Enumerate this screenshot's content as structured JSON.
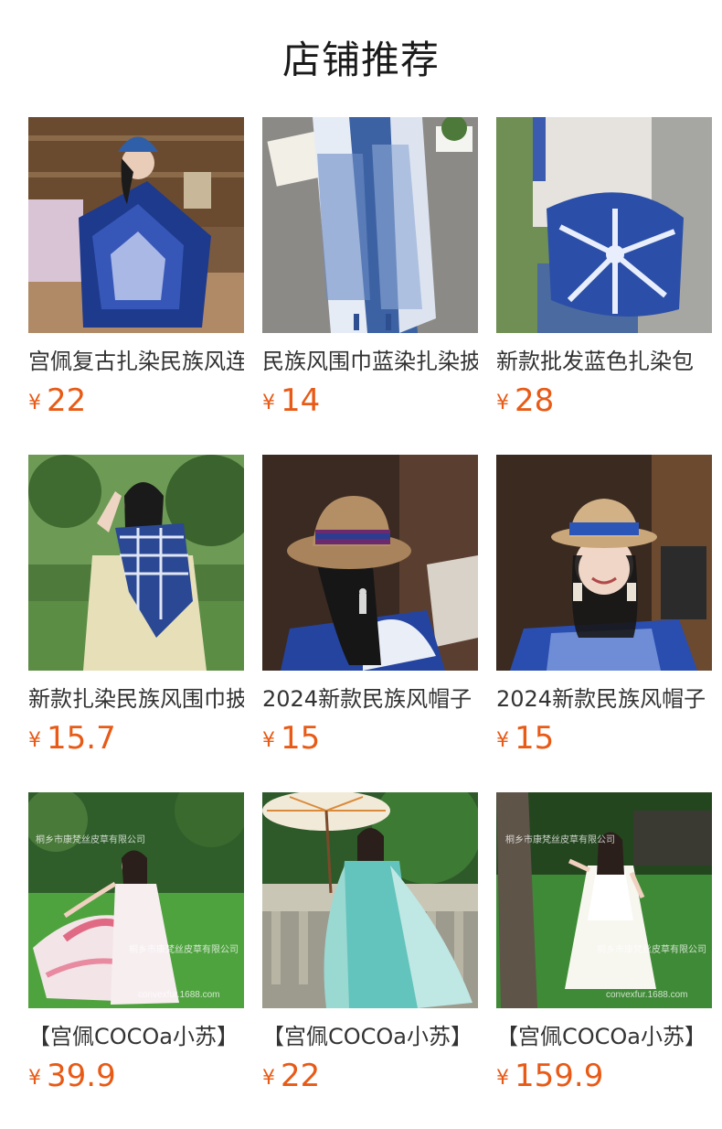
{
  "header": {
    "title": "店铺推荐"
  },
  "currency_symbol": "¥",
  "colors": {
    "price": "#e85a16",
    "title": "#333333"
  },
  "products": [
    {
      "title": "宫佩复古扎染民族风连衣裙",
      "price": "22",
      "image": "woman-indigo-tie-dye-dress"
    },
    {
      "title": "民族风围巾蓝染扎染披肩",
      "price": "14",
      "image": "blue-white-scarf"
    },
    {
      "title": "新款批发蓝色扎染包",
      "price": "28",
      "image": "indigo-tie-dye-bag"
    },
    {
      "title": "新款扎染民族风围巾披肩",
      "price": "15.7",
      "image": "woman-checked-scarf"
    },
    {
      "title": "2024新款民族风帽子",
      "price": "15",
      "image": "woman-straw-hat-back"
    },
    {
      "title": "2024新款民族风帽子",
      "price": "15",
      "image": "girl-straw-hat-smiling"
    },
    {
      "title": "【宫佩COCOa小苏】",
      "price": "39.9",
      "image": "woman-pink-dress-lawn",
      "watermark_top": "桐乡市康梵丝皮草有限公司",
      "watermark_mid": "桐乡市康梵丝皮草有限公司",
      "watermark_bottom": "convexfur.1688.com"
    },
    {
      "title": "【宫佩COCOa小苏】",
      "price": "22",
      "image": "woman-teal-dress-parasol"
    },
    {
      "title": "【宫佩COCOa小苏】",
      "price": "159.9",
      "image": "woman-white-dress-lawn",
      "watermark_top": "桐乡市康梵丝皮草有限公司",
      "watermark_mid": "桐乡市康梵丝皮草有限公司",
      "watermark_bottom": "convexfur.1688.com"
    }
  ]
}
